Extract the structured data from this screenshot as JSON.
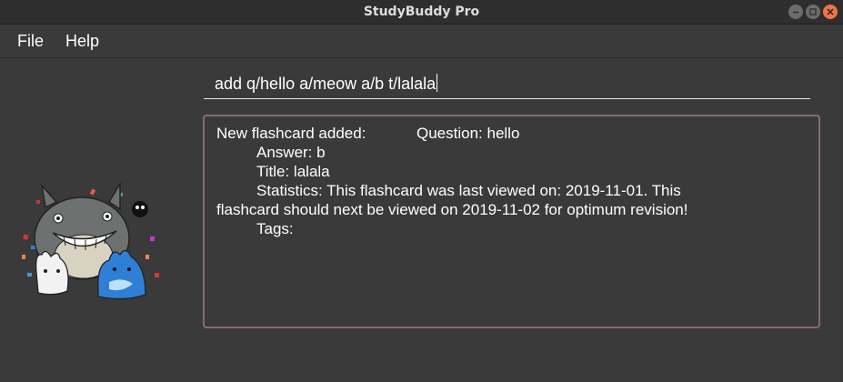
{
  "window": {
    "title": "StudyBuddy Pro"
  },
  "menu": {
    "file": "File",
    "help": "Help"
  },
  "command": {
    "value": "add q/hello a/meow a/b t/lalala"
  },
  "result": {
    "line1_prefix": "New flashcard added:",
    "line1_question": "Question: hello",
    "answer": "Answer: b",
    "title": "Title: lalala",
    "statistics": "Statistics: This flashcard was last viewed on: 2019-11-01. This",
    "statistics_cont": "flashcard should next be viewed on 2019-11-02 for optimum revision!",
    "tags": "Tags:"
  },
  "colors": {
    "background": "#3a3a3a",
    "result_border": "#8c6a6a",
    "close_button": "#f0734a"
  },
  "icons": [
    "minimize-icon",
    "maximize-icon",
    "close-icon",
    "totoro-mascot"
  ]
}
